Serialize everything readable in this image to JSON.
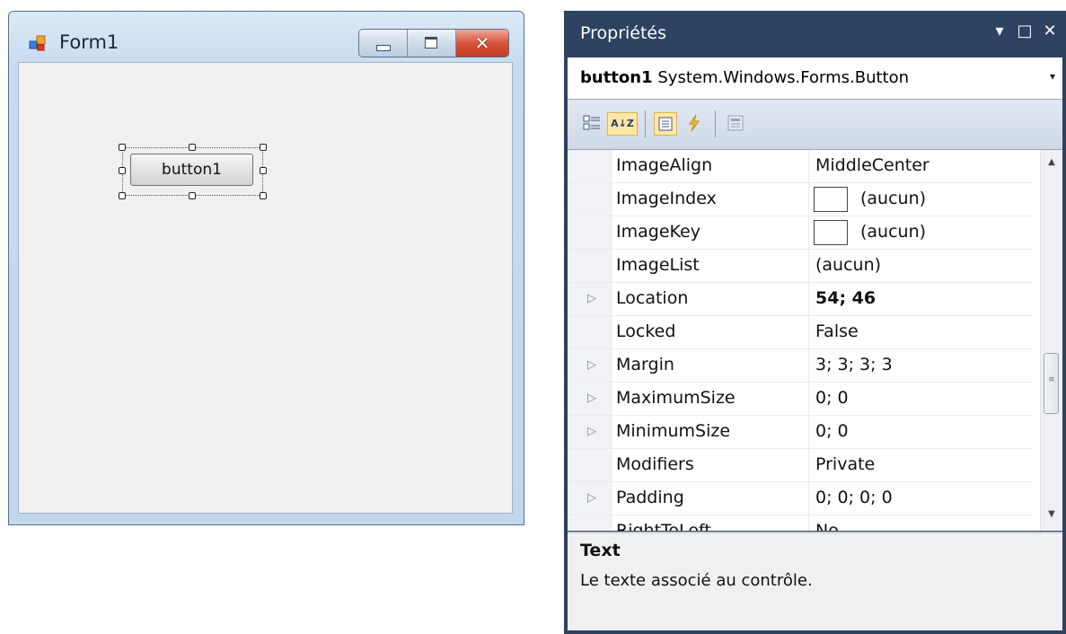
{
  "form": {
    "title": "Form1",
    "button_text": "button1",
    "caption_close": "✕"
  },
  "properties": {
    "title": "Propriétés",
    "titlebar_icons": [
      "▾",
      "□",
      "✕"
    ],
    "selected_object_name": "button1",
    "selected_object_type": "System.Windows.Forms.Button",
    "dropdown_arrow": "▾",
    "toolbar": [
      "categorized-icon",
      "alphabetical-icon",
      "properties-icon",
      "events-icon",
      "property-pages-icon"
    ],
    "alphabetical_label": "A↓Z",
    "rows": [
      {
        "name": "ImageAlign",
        "value": "MiddleCenter",
        "expander": "",
        "swatch": false,
        "bold": false
      },
      {
        "name": "ImageIndex",
        "value": "(aucun)",
        "expander": "",
        "swatch": true,
        "bold": false
      },
      {
        "name": "ImageKey",
        "value": "(aucun)",
        "expander": "",
        "swatch": true,
        "bold": false
      },
      {
        "name": "ImageList",
        "value": "(aucun)",
        "expander": "",
        "swatch": false,
        "bold": false
      },
      {
        "name": "Location",
        "value": "54; 46",
        "expander": "▷",
        "swatch": false,
        "bold": true
      },
      {
        "name": "Locked",
        "value": "False",
        "expander": "",
        "swatch": false,
        "bold": false
      },
      {
        "name": "Margin",
        "value": "3; 3; 3; 3",
        "expander": "▷",
        "swatch": false,
        "bold": false
      },
      {
        "name": "MaximumSize",
        "value": "0; 0",
        "expander": "▷",
        "swatch": false,
        "bold": false
      },
      {
        "name": "MinimumSize",
        "value": "0; 0",
        "expander": "▷",
        "swatch": false,
        "bold": false
      },
      {
        "name": "Modifiers",
        "value": "Private",
        "expander": "",
        "swatch": false,
        "bold": false
      },
      {
        "name": "Padding",
        "value": "0; 0; 0; 0",
        "expander": "▷",
        "swatch": false,
        "bold": false
      },
      {
        "name": "RightToLeft",
        "value": "No",
        "expander": "",
        "swatch": false,
        "bold": false
      }
    ],
    "scroll_up": "▲",
    "scroll_down": "▼",
    "description_title": "Text",
    "description_text": "Le texte associé au contrôle."
  }
}
